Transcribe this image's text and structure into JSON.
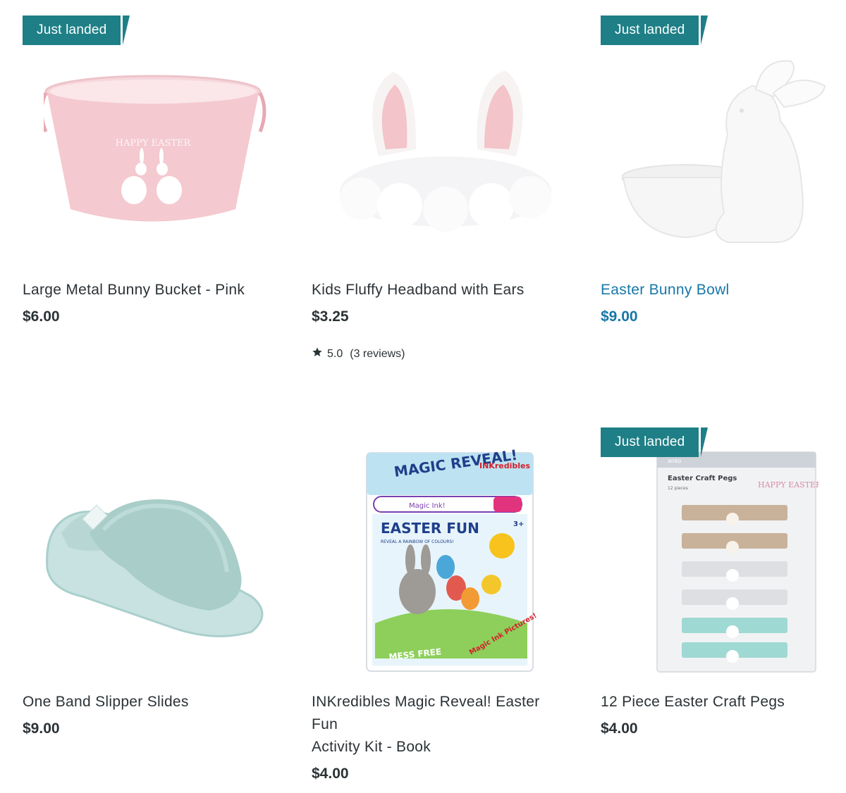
{
  "badge_text": "Just landed",
  "products": [
    {
      "title": "Large Metal Bunny Bucket - Pink",
      "price": "$6.00",
      "badge": true
    },
    {
      "title": "Kids Fluffy Headband with Ears",
      "price": "$3.25",
      "badge": false,
      "rating": {
        "score": "5.0",
        "reviews": "(3 reviews)"
      }
    },
    {
      "title": "Easter Bunny Bowl",
      "price": "$9.00",
      "badge": true,
      "hovered": true
    },
    {
      "title": "One Band Slipper Slides",
      "price": "$9.00",
      "badge": false
    },
    {
      "title_line1": "INKredibles Magic Reveal! Easter Fun",
      "title_line2": "Activity Kit - Book",
      "price": "$4.00",
      "badge": false,
      "packaging": {
        "brand": "INKredibles",
        "heading": "MAGIC REVEAL!",
        "pen": "Magic Ink!",
        "subtitle": "EASTER FUN",
        "tagline": "REVEAL A RAINBOW OF COLOURS!",
        "corner": "3+",
        "footer": "MESS FREE",
        "sticker": "Magic Ink Pictures!"
      }
    },
    {
      "title": "12 Piece Easter Craft Pegs",
      "price": "$4.00",
      "badge": true,
      "packaging": {
        "label": "Easter Craft Pegs",
        "count": "12 pieces",
        "brand": "anko",
        "slogan": "HAPPY EASTER"
      }
    }
  ],
  "bucket_print": "HAPPY EASTER",
  "colors": {
    "badge": "#1e7f86",
    "link": "#1677a8",
    "text": "#2b3236"
  }
}
